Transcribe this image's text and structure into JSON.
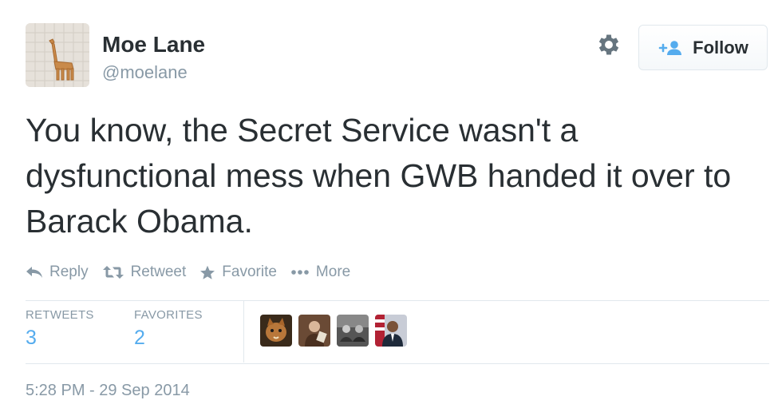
{
  "author": {
    "name": "Moe Lane",
    "handle": "@moelane"
  },
  "follow_button": {
    "label": "Follow"
  },
  "tweet": {
    "text": "You know, the Secret Service wasn't a dysfunctional mess when GWB handed it over to Barack Obama."
  },
  "actions": [
    {
      "label": "Reply",
      "icon": "reply-icon"
    },
    {
      "label": "Retweet",
      "icon": "retweet-icon"
    },
    {
      "label": "Favorite",
      "icon": "star-icon"
    },
    {
      "label": "More",
      "icon": "more-icon"
    }
  ],
  "stats": {
    "retweets": {
      "label": "RETWEETS",
      "value": "3"
    },
    "favorites": {
      "label": "FAVORITES",
      "value": "2"
    }
  },
  "timestamp": "5:28 PM - 29 Sep 2014",
  "colors": {
    "accent": "#55acee",
    "muted": "#8899a6",
    "text": "#292f33",
    "border": "#e1e8ed"
  }
}
